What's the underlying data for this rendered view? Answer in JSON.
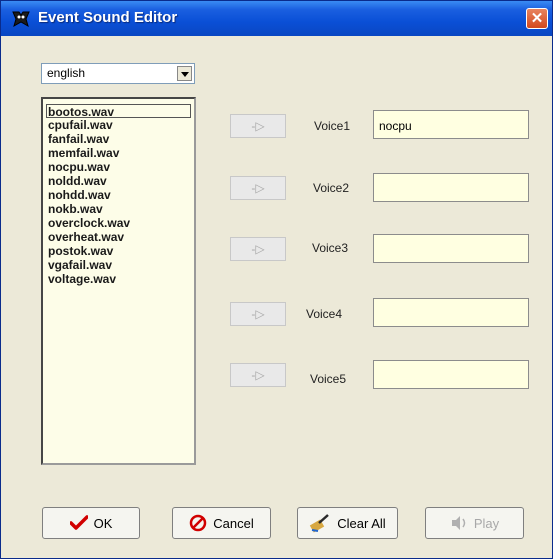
{
  "window": {
    "title": "Event Sound Editor",
    "close_glyph": "✕"
  },
  "language": {
    "selected": "english"
  },
  "sound_files": [
    "bootos.wav",
    "cpufail.wav",
    "fanfail.wav",
    "memfail.wav",
    "nocpu.wav",
    "noldd.wav",
    "nohdd.wav",
    "nokb.wav",
    "overclock.wav",
    "overheat.wav",
    "postok.wav",
    "vgafail.wav",
    "voltage.wav"
  ],
  "selected_file": "bootos.wav",
  "assign_button_label": "-▷",
  "voices": [
    {
      "label": "Voice1",
      "value": "nocpu"
    },
    {
      "label": "Voice2",
      "value": ""
    },
    {
      "label": "Voice3",
      "value": ""
    },
    {
      "label": "Voice4",
      "value": ""
    },
    {
      "label": "Voice5",
      "value": ""
    }
  ],
  "buttons": {
    "ok": "OK",
    "cancel": "Cancel",
    "clear_all": "Clear All",
    "play": "Play"
  },
  "colors": {
    "title_bar": "#0a4fd6",
    "close": "#d3481c",
    "list_bg": "#fdfde8",
    "field_bg": "#ffffe1"
  }
}
